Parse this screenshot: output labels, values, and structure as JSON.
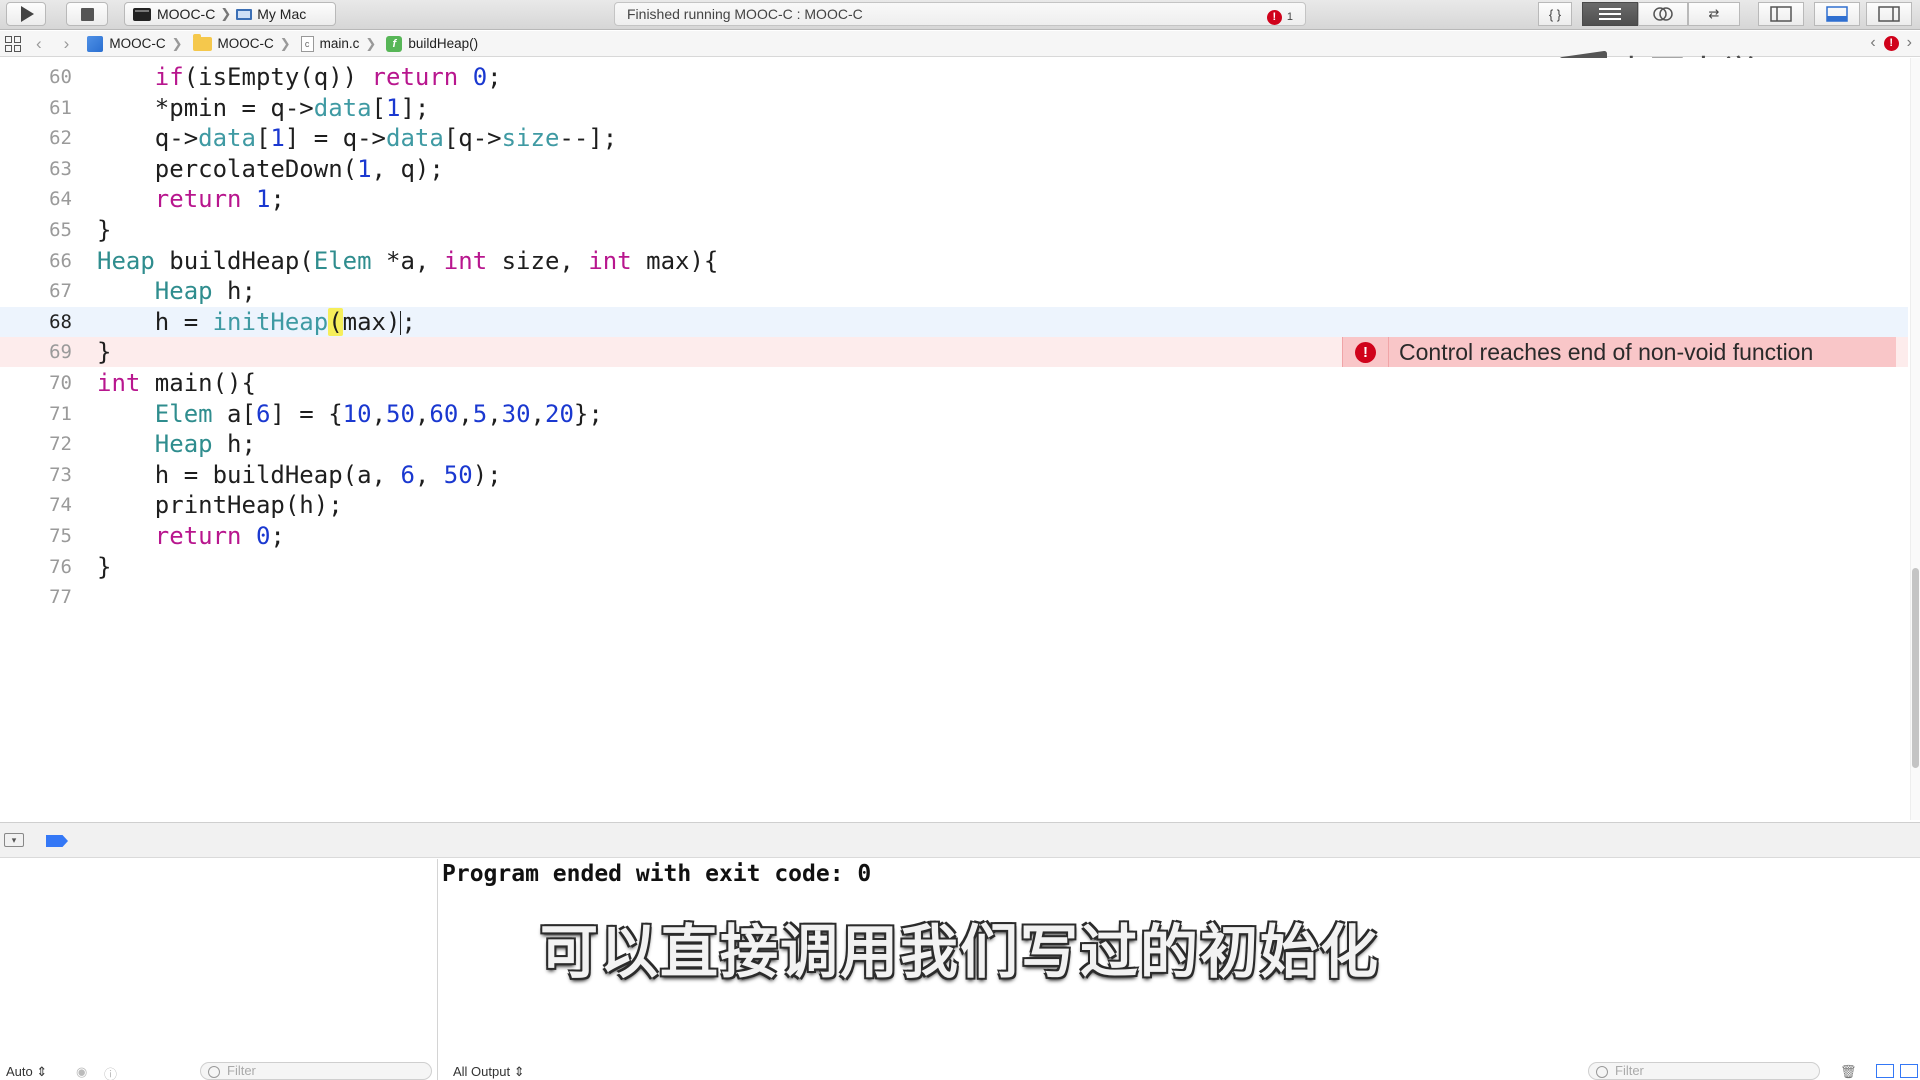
{
  "toolbar": {
    "scheme_project": "MOOC-C",
    "scheme_destination": "My Mac",
    "activity_status": "Finished running MOOC-C : MOOC-C",
    "error_count": "1"
  },
  "jumpbar": {
    "crumbs": [
      "MOOC-C",
      "MOOC-C",
      "main.c",
      "buildHeap()"
    ]
  },
  "watermark": "中国大学MOOC",
  "editor": {
    "lines": [
      {
        "n": "60",
        "tokens": [
          [
            "    ",
            ""
          ],
          [
            "if",
            "kw"
          ],
          [
            "(isEmpty(q)) ",
            ""
          ],
          [
            "return",
            "kw"
          ],
          [
            " ",
            ""
          ],
          [
            "0",
            "num"
          ],
          [
            ";",
            ""
          ]
        ]
      },
      {
        "n": "61",
        "tokens": [
          [
            "    *pmin = q->",
            ""
          ],
          [
            "data",
            "fld"
          ],
          [
            "[",
            ""
          ],
          [
            "1",
            "num"
          ],
          [
            "];",
            ""
          ]
        ]
      },
      {
        "n": "62",
        "tokens": [
          [
            "    q->",
            ""
          ],
          [
            "data",
            "fld"
          ],
          [
            "[",
            ""
          ],
          [
            "1",
            "num"
          ],
          [
            "] = q->",
            ""
          ],
          [
            "data",
            "fld"
          ],
          [
            "[q->",
            ""
          ],
          [
            "size",
            "fld"
          ],
          [
            "--];",
            ""
          ]
        ]
      },
      {
        "n": "63",
        "tokens": [
          [
            "    percolateDown(",
            ""
          ],
          [
            "1",
            "num"
          ],
          [
            ", q);",
            ""
          ]
        ]
      },
      {
        "n": "64",
        "tokens": [
          [
            "    ",
            ""
          ],
          [
            "return",
            "kw"
          ],
          [
            " ",
            ""
          ],
          [
            "1",
            "num"
          ],
          [
            ";",
            ""
          ]
        ]
      },
      {
        "n": "65",
        "tokens": [
          [
            "}",
            ""
          ]
        ]
      },
      {
        "n": "66",
        "tokens": [
          [
            "Heap",
            "ty"
          ],
          [
            " buildHeap(",
            ""
          ],
          [
            "Elem",
            "ty"
          ],
          [
            " *a, ",
            ""
          ],
          [
            "int",
            "kw"
          ],
          [
            " size, ",
            ""
          ],
          [
            "int",
            "kw"
          ],
          [
            " max){",
            ""
          ]
        ]
      },
      {
        "n": "67",
        "tokens": [
          [
            "    ",
            ""
          ],
          [
            "Heap",
            "ty"
          ],
          [
            " h;",
            ""
          ]
        ]
      },
      {
        "n": "68",
        "tokens": [
          [
            "    h = ",
            ""
          ],
          [
            "initHeap",
            "fld"
          ],
          [
            "(",
            "paren"
          ],
          [
            "max)",
            ""
          ],
          [
            "|",
            "caret"
          ],
          [
            ";",
            ""
          ]
        ]
      },
      {
        "n": "69",
        "tokens": [
          [
            "}",
            ""
          ]
        ]
      },
      {
        "n": "70",
        "tokens": [
          [
            "int",
            "kw"
          ],
          [
            " main(){",
            ""
          ]
        ]
      },
      {
        "n": "71",
        "tokens": [
          [
            "    ",
            ""
          ],
          [
            "Elem",
            "ty"
          ],
          [
            " a[",
            ""
          ],
          [
            "6",
            "num"
          ],
          [
            "] = {",
            ""
          ],
          [
            "10",
            "num"
          ],
          [
            ",",
            ""
          ],
          [
            "50",
            "num"
          ],
          [
            ",",
            ""
          ],
          [
            "60",
            "num"
          ],
          [
            ",",
            ""
          ],
          [
            "5",
            "num"
          ],
          [
            ",",
            ""
          ],
          [
            "30",
            "num"
          ],
          [
            ",",
            ""
          ],
          [
            "20",
            "num"
          ],
          [
            "};",
            ""
          ]
        ]
      },
      {
        "n": "72",
        "tokens": [
          [
            "    ",
            ""
          ],
          [
            "Heap",
            "ty"
          ],
          [
            " h;",
            ""
          ]
        ]
      },
      {
        "n": "73",
        "tokens": [
          [
            "    h = buildHeap(a, ",
            ""
          ],
          [
            "6",
            "num"
          ],
          [
            ", ",
            ""
          ],
          [
            "50",
            "num"
          ],
          [
            ");",
            ""
          ]
        ]
      },
      {
        "n": "74",
        "tokens": [
          [
            "    printHeap(h);",
            ""
          ]
        ]
      },
      {
        "n": "75",
        "tokens": [
          [
            "    ",
            ""
          ],
          [
            "return",
            "kw"
          ],
          [
            " ",
            ""
          ],
          [
            "0",
            "num"
          ],
          [
            ";",
            ""
          ]
        ]
      },
      {
        "n": "76",
        "tokens": [
          [
            "}",
            ""
          ]
        ]
      },
      {
        "n": "77",
        "tokens": []
      }
    ],
    "current_line": "68",
    "error_line": "69",
    "error_message": "Control reaches end of non-void function"
  },
  "debug": {
    "console_output": "Program ended with exit code: 0",
    "auto_label": "Auto",
    "filter_placeholder": "Filter",
    "output_selector": "All Output"
  },
  "subtitle": "可以直接调用我们写过的初始化",
  "colors": {
    "keyword": "#b8168e",
    "type": "#2f8d8e",
    "number": "#1a38d0",
    "error": "#d0021b",
    "current_line_bg": "#edf4fd",
    "error_line_bg": "#fdecec"
  }
}
